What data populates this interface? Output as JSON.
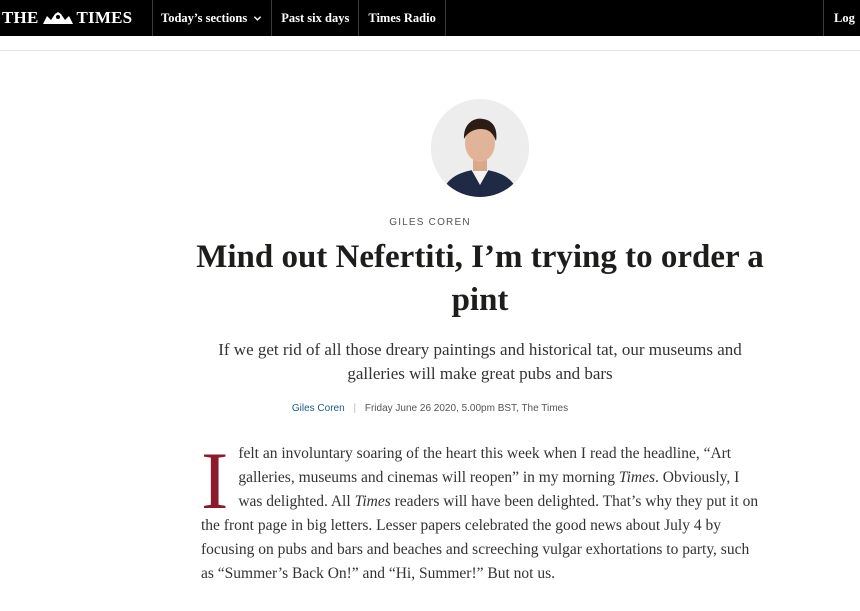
{
  "nav": {
    "logo_left": "THE",
    "logo_right": "TIMES",
    "items": [
      {
        "label": "Today’s sections",
        "has_dropdown": true
      },
      {
        "label": "Past six days",
        "has_dropdown": false
      },
      {
        "label": "Times Radio",
        "has_dropdown": false
      }
    ],
    "login_label": "Log"
  },
  "article": {
    "author_tag": "GILES COREN",
    "headline": "Mind out Nefertiti, I’m trying to order a pint",
    "standfirst": "If we get rid of all those dreary paintings and historical tat, our museums and galleries will make great pubs and bars",
    "byline": {
      "author": "Giles Coren",
      "date": "Friday June 26 2020, 5.00pm BST, The Times"
    },
    "body": {
      "dropcap": "I",
      "p1_a": " felt an involuntary soaring of the heart this week when I read the headline, “Art galleries, museums and cinemas will reopen” in my morning ",
      "p1_em1": "Times",
      "p1_b": ". Obviously, I was delighted. All ",
      "p1_em2": "Times",
      "p1_c": " readers will have been delighted. That’s why they put it on the front page in big letters. Lesser papers celebrated the good news about July 4 by focusing on pubs and bars and beaches and screeching vulgar exhortations to party, such as “Summer’s Back On!” and “Hi, Summer!” But not us."
    }
  },
  "colors": {
    "nav_bg": "#000000",
    "dropcap": "#8b1a2b",
    "byline_link": "#1a5a8a"
  }
}
